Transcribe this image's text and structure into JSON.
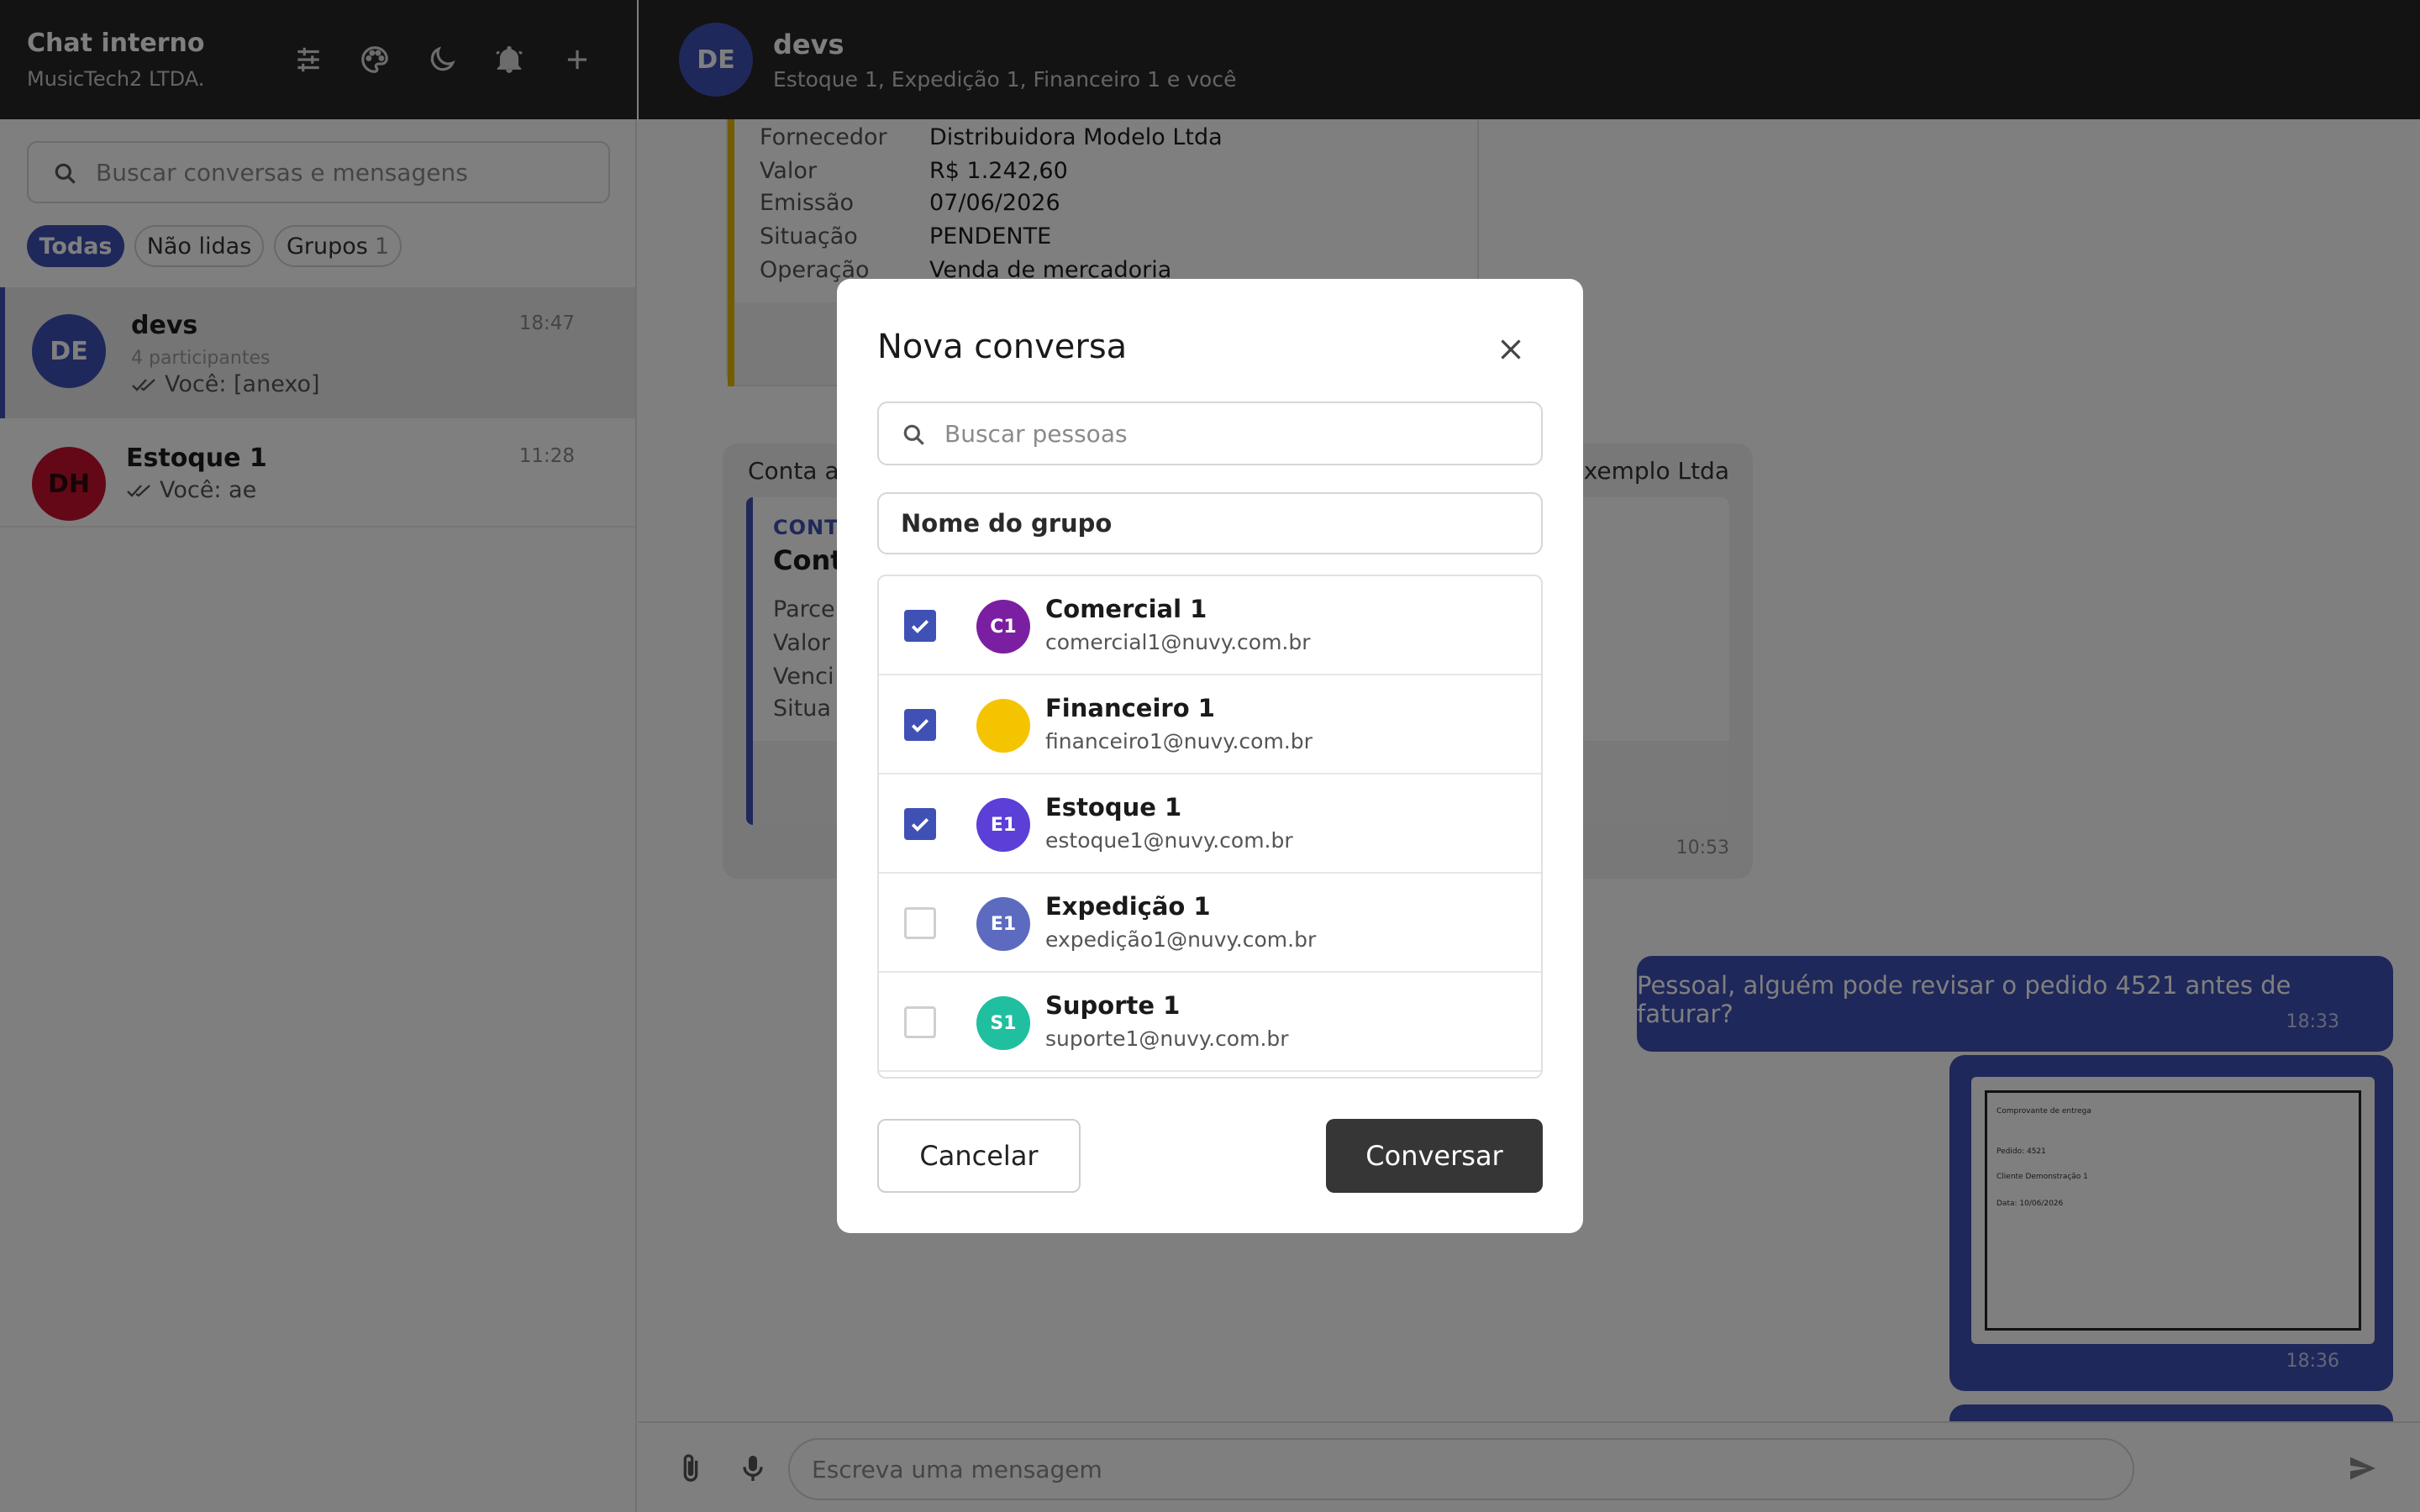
{
  "sidebar": {
    "title": "Chat interno",
    "company": "MusicTech2 LTDA.",
    "search_placeholder": "Buscar conversas e mensagens",
    "filters": {
      "all": "Todas",
      "unread": "Não lidas",
      "groups": "Grupos",
      "groups_count": "1"
    },
    "header_icons": [
      "sliders-icon",
      "palette-icon",
      "moon-icon",
      "bell-icon",
      "plus-icon"
    ],
    "conversations": [
      {
        "initials": "DE",
        "name": "devs",
        "subtitle": "4 participantes",
        "last": "Você: [anexo]",
        "time": "18:47",
        "avatar_color": "#3f51b5",
        "active": true
      },
      {
        "initials": "DH",
        "name": "Estoque 1",
        "last": "Você: ae",
        "time": "11:28",
        "avatar_color": "#c8102e",
        "active": false
      }
    ]
  },
  "chat": {
    "initials": "DE",
    "title": "devs",
    "subtitle": "Estoque 1, Expedição 1, Financeiro 1 e você",
    "card1": {
      "labels": [
        "Fornecedor",
        "Valor",
        "Emissão",
        "Situação",
        "Operação"
      ],
      "values": [
        "Distribuidora Modelo Ltda",
        "R$ 1.242,60",
        "07/06/2026",
        "PENDENTE",
        "Venda de mercadoria"
      ]
    },
    "message2": {
      "text_left": "Conta a",
      "text_right": "xemplo Ltda",
      "tag": "CONT",
      "title": "Cont",
      "labels": [
        "Parce",
        "Valor",
        "Venci",
        "Situa"
      ],
      "time": "10:53"
    },
    "message3": {
      "text": "Pessoal, alguém pode revisar o pedido 4521 antes de faturar?",
      "time": "18:33"
    },
    "message4": {
      "doc_lines": [
        "Comprovante de entrega",
        "Pedido: 4521",
        "Cliente Demonstração 1",
        "Data: 10/06/2026"
      ],
      "time": "18:36"
    },
    "composer_placeholder": "Escreva uma mensagem"
  },
  "modal": {
    "title": "Nova conversa",
    "search_placeholder": "Buscar pessoas",
    "group_name_placeholder": "Nome do grupo",
    "people": [
      {
        "initials": "C1",
        "name": "Comercial 1",
        "email": "comercial1@nuvy.com.br",
        "color": "#7b1fa2",
        "checked": true
      },
      {
        "initials": "",
        "name": "Financeiro 1",
        "email": "financeiro1@nuvy.com.br",
        "color": "#f5c400",
        "checked": true
      },
      {
        "initials": "E1",
        "name": "Estoque 1",
        "email": "estoque1@nuvy.com.br",
        "color": "#5b3fd6",
        "checked": true
      },
      {
        "initials": "E1",
        "name": "Expedição 1",
        "email": "expedição1@nuvy.com.br",
        "color": "#5c6bc0",
        "checked": false
      },
      {
        "initials": "S1",
        "name": "Suporte 1",
        "email": "suporte1@nuvy.com.br",
        "color": "#1fbf9f",
        "checked": false
      }
    ],
    "cancel_label": "Cancelar",
    "submit_label": "Conversar"
  }
}
